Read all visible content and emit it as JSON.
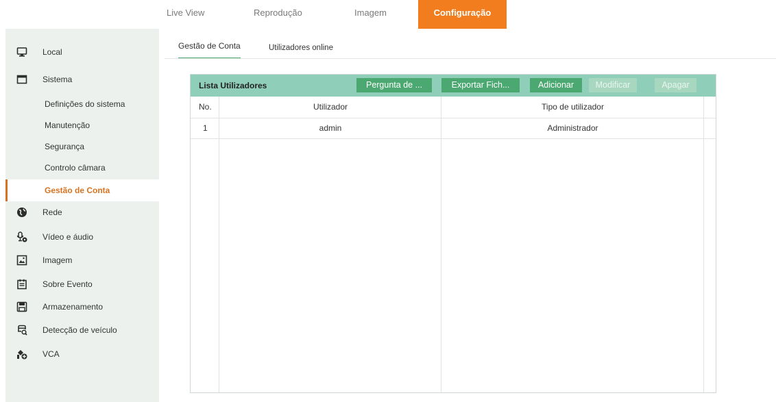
{
  "topnav": {
    "tabs": [
      {
        "label": "Live View"
      },
      {
        "label": "Reprodução"
      },
      {
        "label": "Imagem"
      },
      {
        "label": "Configuração"
      }
    ],
    "active_tab": "Configuração",
    "active_color": "#f27d1e"
  },
  "sidebar": {
    "items": [
      {
        "label": "Local",
        "icon": "monitor-icon"
      },
      {
        "label": "Sistema",
        "icon": "window-icon"
      },
      {
        "label": "Definições do sistema"
      },
      {
        "label": "Manutenção"
      },
      {
        "label": "Segurança"
      },
      {
        "label": "Controlo câmara"
      },
      {
        "label": "Gestão de Conta"
      },
      {
        "label": "Rede",
        "icon": "globe-icon"
      },
      {
        "label": "Vídeo e áudio",
        "icon": "mic-icon"
      },
      {
        "label": "Imagem",
        "icon": "image-icon"
      },
      {
        "label": "Sobre Evento",
        "icon": "calendar-icon"
      },
      {
        "label": "Armazenamento",
        "icon": "save-icon"
      },
      {
        "label": "Detecção de veículo",
        "icon": "vehicle-search-icon"
      },
      {
        "label": "VCA",
        "icon": "vca-icon"
      }
    ],
    "active_item": "Gestão de Conta",
    "accent": "#d77320"
  },
  "subtabs": [
    {
      "label": "Gestão de Conta"
    },
    {
      "label": "Utilizadores online"
    }
  ],
  "user_list": {
    "title": "Lista Utilizadores",
    "buttons": {
      "question": "Pergunta de ...",
      "export": "Exportar Fich...",
      "add": "Adicionar",
      "modify": "Modificar",
      "delete": "Apagar"
    },
    "columns": [
      "No.",
      "Utilizador",
      "Tipo de utilizador"
    ],
    "rows": [
      {
        "no": "1",
        "user": "admin",
        "type": "Administrador"
      }
    ],
    "header_color": "#8fcfb9",
    "button_color": "#4aa870"
  }
}
